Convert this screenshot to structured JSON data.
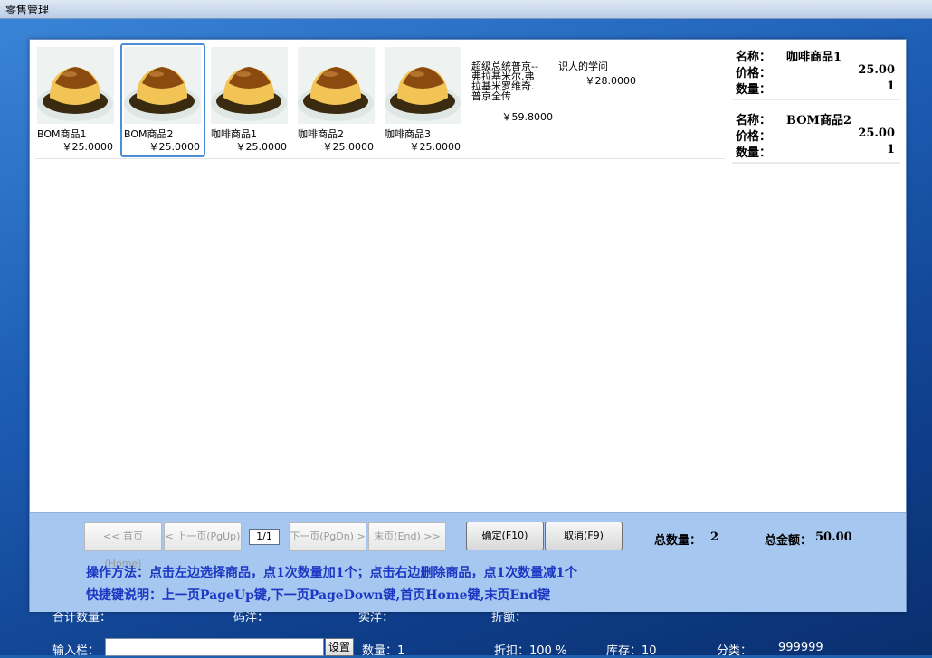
{
  "window": {
    "title": "零售管理"
  },
  "products": [
    {
      "name": "BOM商品1",
      "price": "￥25.0000",
      "selected": false
    },
    {
      "name": "BOM商品2",
      "price": "￥25.0000",
      "selected": true
    },
    {
      "name": "咖啡商品1",
      "price": "￥25.0000",
      "selected": false
    },
    {
      "name": "咖啡商品2",
      "price": "￥25.0000",
      "selected": false
    },
    {
      "name": "咖啡商品3",
      "price": "￥25.0000",
      "selected": false
    }
  ],
  "text_products": [
    {
      "name": "超级总统普京--弗拉基米尔.弗拉基米罗维奇.普京全传",
      "price": "￥59.8000"
    },
    {
      "name": "识人的学问",
      "price": "￥28.0000"
    }
  ],
  "cart": {
    "labels": {
      "name": "名称：",
      "price": "价格：",
      "qty": "数量："
    },
    "items": [
      {
        "name": "咖啡商品1",
        "price": "25.00",
        "qty": "1"
      },
      {
        "name": "BOM商品2",
        "price": "25.00",
        "qty": "1"
      }
    ]
  },
  "pager": {
    "first": "<< 首页(Home)",
    "prev": "< 上一页(PgUp)",
    "page": "1/1",
    "next": "下一页(PgDn) >",
    "last": "末页(End) >>"
  },
  "actions": {
    "confirm": "确定(F10)",
    "cancel": "取消(F9)"
  },
  "totals": {
    "qty_label": "总数量：",
    "qty_value": "2",
    "amount_label": "总金额：",
    "amount_value": "50.00"
  },
  "help": {
    "operation": "操作方法：点击左边选择商品，点1次数量加1个；点击右边删除商品，点1次数量减1个",
    "shortcuts": "快捷键说明：上一页PageUp键,下一页PageDown键,首页Home键,末页End键"
  },
  "status_bar": {
    "total_qty": "合计数量：",
    "code": "码洋：",
    "actual": "实洋：",
    "discount_amt": "折额：",
    "input_label": "输入栏：",
    "set_button": "设置",
    "qty": "数量：1",
    "discount": "折扣：100  %",
    "stock": "库存：10",
    "category": "分类：",
    "category_value": "999999"
  },
  "colors": {
    "accent": "#4f8ed6",
    "footer": "#a6c7ef",
    "help_text": "#1b37c4"
  }
}
